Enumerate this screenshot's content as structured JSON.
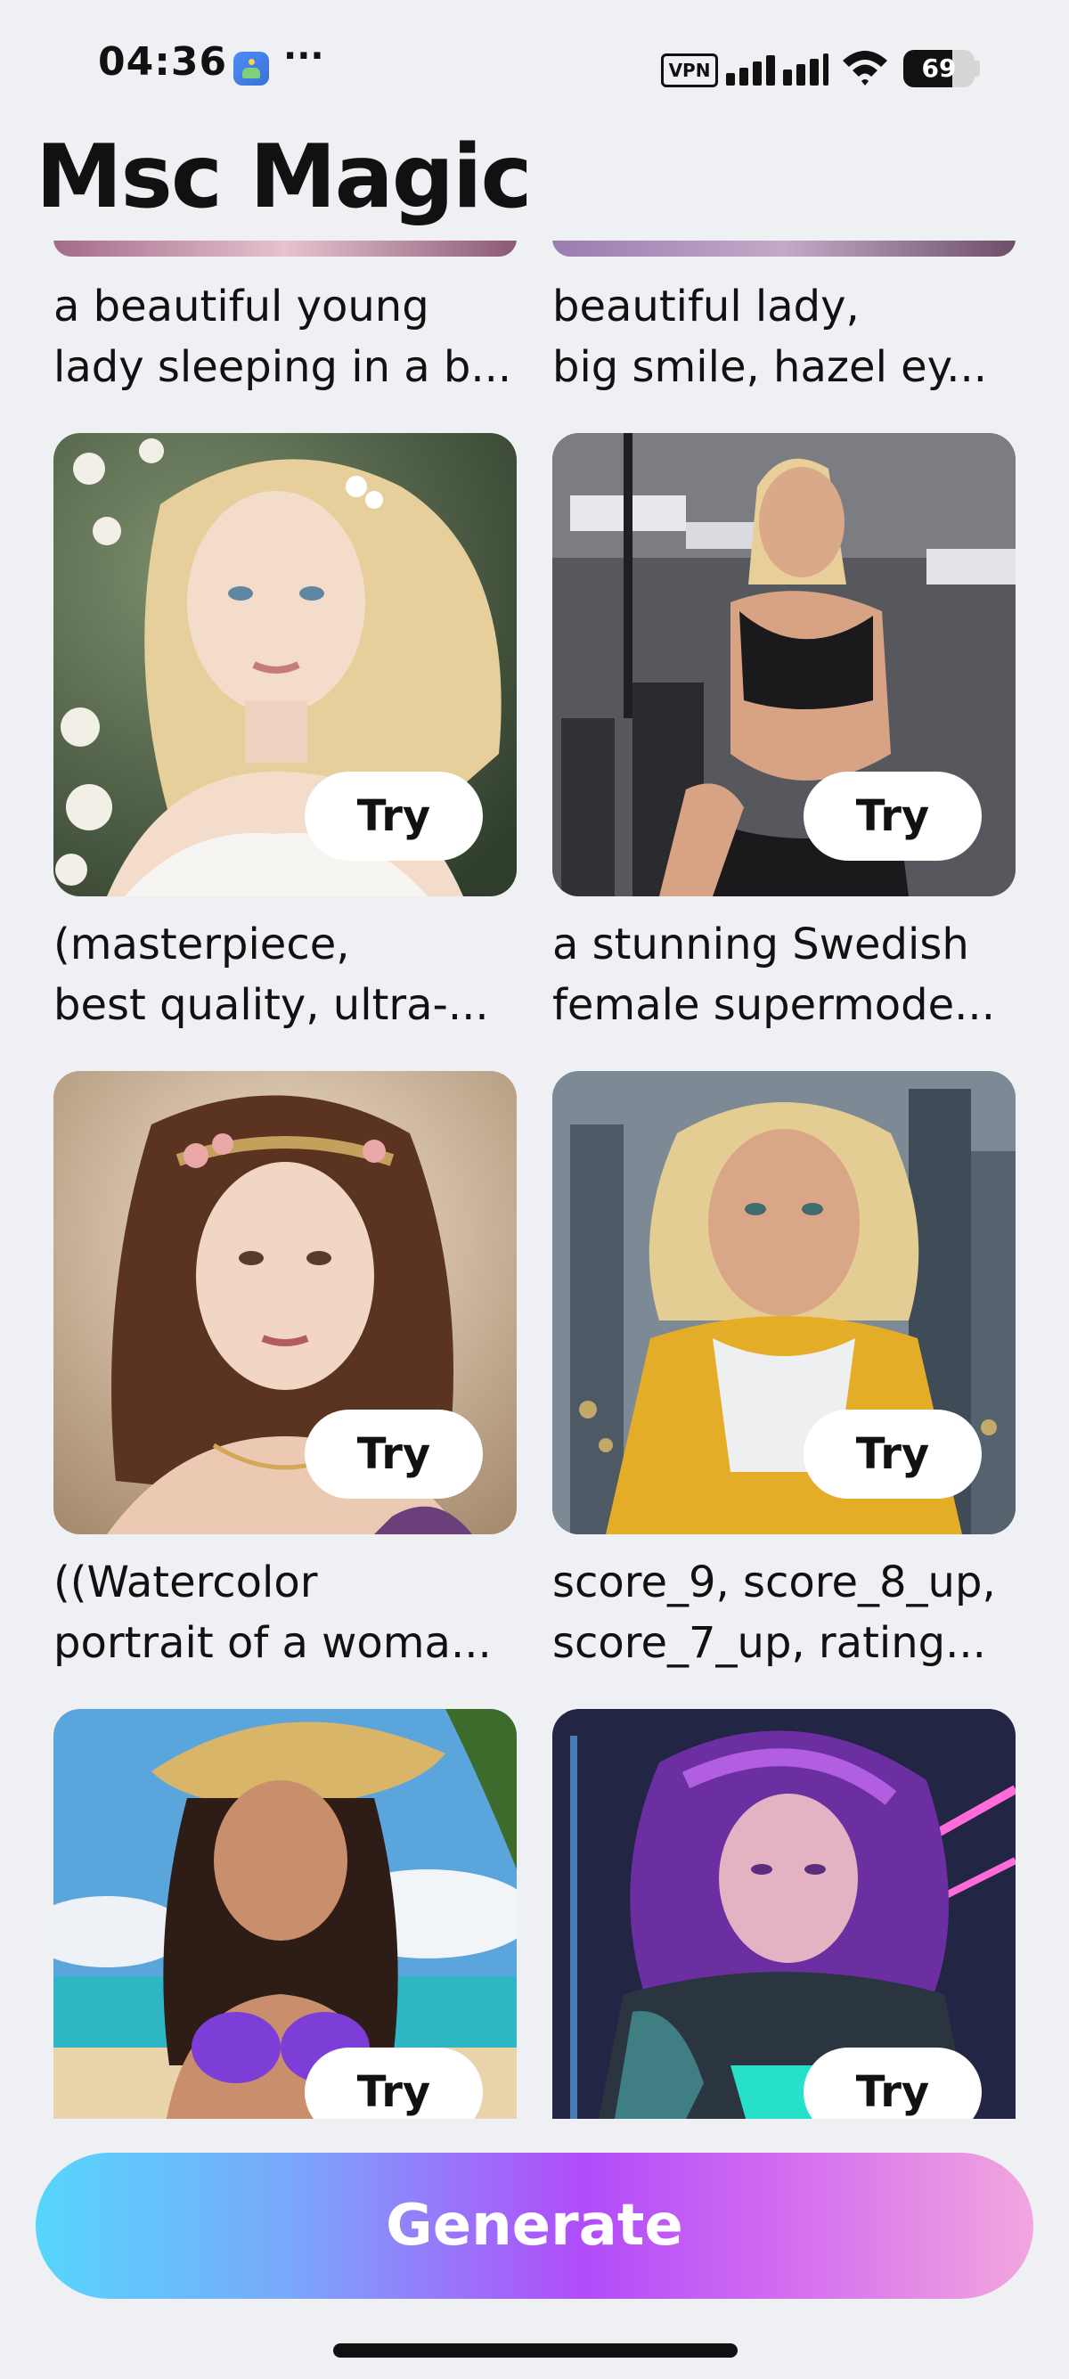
{
  "status_bar": {
    "time": "04:36",
    "more": "···",
    "vpn": "VPN",
    "battery": "69",
    "battery_level_percent": 69
  },
  "app": {
    "title": "Msc Magic"
  },
  "top_row": [
    {
      "line1": "a beautiful young",
      "line2": "lady sleeping in a b..."
    },
    {
      "line1": "beautiful lady,",
      "line2": "big smile, hazel ey..."
    }
  ],
  "cards": [
    {
      "line1": "(masterpiece,",
      "line2": "best quality, ultra-...",
      "try": "Try"
    },
    {
      "line1": "a stunning Swedish",
      "line2": "female supermode...",
      "try": "Try"
    },
    {
      "line1": "((Watercolor",
      "line2": "portrait of a woma...",
      "try": "Try"
    },
    {
      "line1": "score_9, score_8_up,",
      "line2": "score_7_up, rating...",
      "try": "Try"
    },
    {
      "line1": "",
      "line2": "",
      "try": "Try"
    },
    {
      "line1": "",
      "line2": "",
      "try": "Try"
    }
  ],
  "generate_label": "Generate",
  "colors": {
    "background": "#eff0f4",
    "gradient_start": "#55d6fb",
    "gradient_mid": "#b14cf9",
    "gradient_end": "#f2a6de"
  }
}
